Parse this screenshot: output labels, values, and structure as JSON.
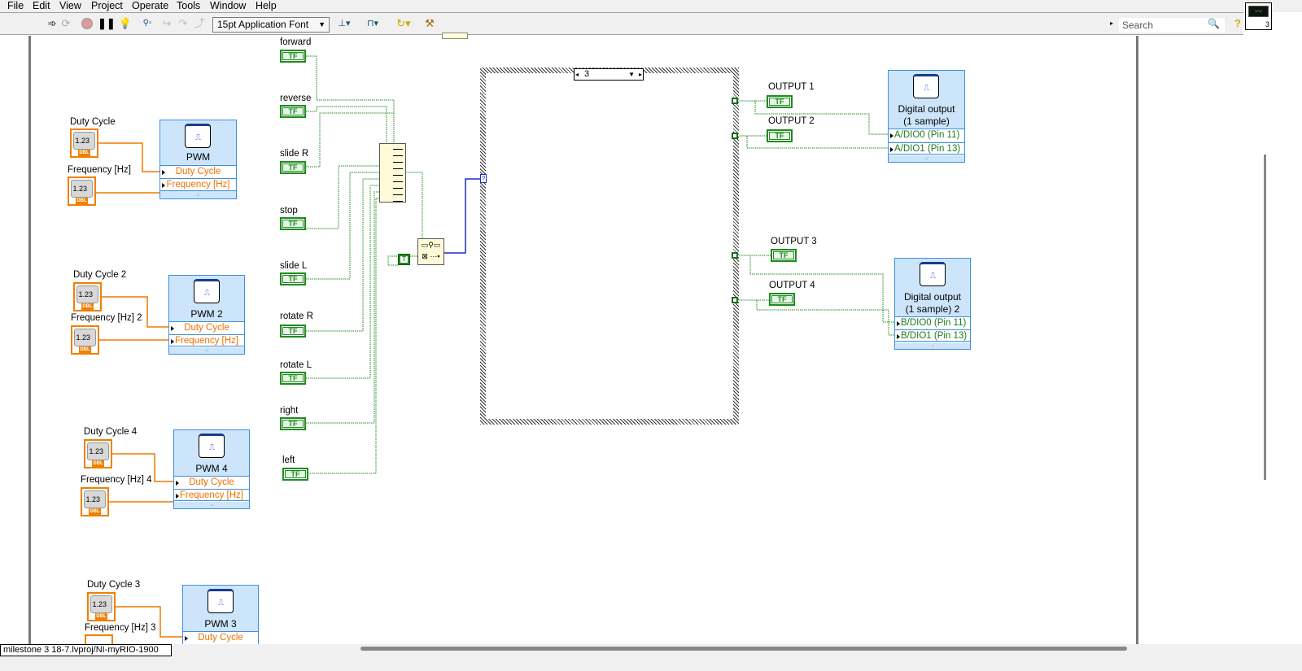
{
  "menu": [
    "File",
    "Edit",
    "View",
    "Project",
    "Operate",
    "Tools",
    "Window",
    "Help"
  ],
  "toolbar": {
    "font": "15pt Application Font",
    "search_placeholder": "Search",
    "help": "?",
    "vi_icon_number": "3"
  },
  "glyphs": {
    "numeric": "1.23",
    "type": "DBL",
    "boolean": "TF"
  },
  "pwm_blocks": [
    {
      "title": "PWM",
      "duty_label": "Duty Cycle",
      "freq_label": "Frequency [Hz]",
      "input_duty": "Duty Cycle",
      "input_freq": "Frequency [Hz]"
    },
    {
      "title": "PWM 2",
      "duty_label": "Duty Cycle 2",
      "freq_label": "Frequency [Hz] 2",
      "input_duty": "Duty Cycle",
      "input_freq": "Frequency [Hz]"
    },
    {
      "title": "PWM 4",
      "duty_label": "Duty Cycle 4",
      "freq_label": "Frequency [Hz] 4",
      "input_duty": "Duty Cycle",
      "input_freq": "Frequency [Hz]"
    },
    {
      "title": "PWM 3",
      "duty_label": "Duty Cycle 3",
      "freq_label": "Frequency [Hz] 3",
      "input_duty": "Duty Cycle"
    }
  ],
  "booleans": [
    "forward",
    "reverse",
    "slide R",
    "stop",
    "slide L",
    "rotate R",
    "rotate L",
    "right",
    "left"
  ],
  "case_selector": "3",
  "selector_terminal": "?",
  "true_constant": "T",
  "outputs": [
    "OUTPUT 1",
    "OUTPUT 2",
    "OUTPUT 3",
    "OUTPUT 4"
  ],
  "digital_outputs": [
    {
      "line1": "Digital output",
      "line2": "(1 sample)",
      "inputs": [
        "A/DIO0 (Pin 11)",
        "A/DIO1 (Pin 13)"
      ]
    },
    {
      "line1": "Digital output",
      "line2": "(1 sample) 2",
      "inputs": [
        "B/DIO0 (Pin 11)",
        "B/DIO1 (Pin 13)"
      ]
    }
  ],
  "status_bar": {
    "project": "milestone 3 18-7.lvproj/NI-myRIO-1900"
  }
}
